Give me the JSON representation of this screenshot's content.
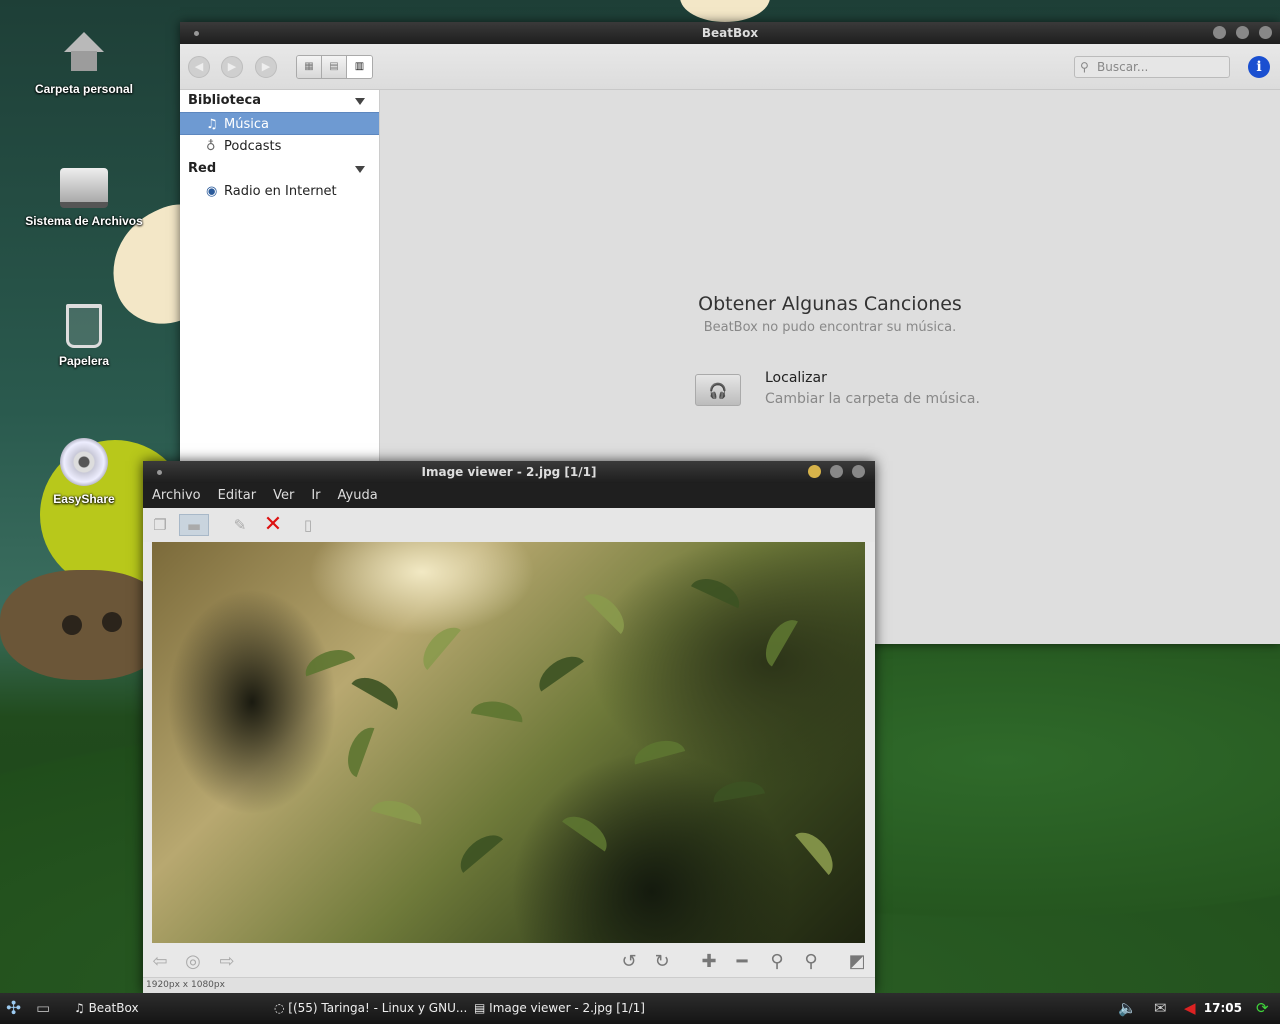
{
  "desktop": {
    "icons": [
      {
        "label": "Carpeta personal",
        "icon": "home-folder-icon"
      },
      {
        "label": "Sistema de Archivos",
        "icon": "drive-icon"
      },
      {
        "label": "Papelera",
        "icon": "trash-icon"
      },
      {
        "label": "EasyShare",
        "icon": "cd-icon"
      }
    ]
  },
  "beatbox": {
    "title": "BeatBox",
    "search_placeholder": "Buscar...",
    "info_label": "i",
    "sidebar": {
      "library_heading": "Biblioteca",
      "library_items": [
        {
          "label": "Música",
          "icon": "music-note-icon",
          "selected": true
        },
        {
          "label": "Podcasts",
          "icon": "podcast-icon",
          "selected": false
        }
      ],
      "network_heading": "Red",
      "network_items": [
        {
          "label": "Radio en Internet",
          "icon": "radio-icon"
        }
      ]
    },
    "empty": {
      "title": "Obtener Algunas Canciones",
      "subtitle": "BeatBox no pudo encontrar su música.",
      "action_title": "Localizar",
      "action_subtitle": "Cambiar la carpeta de música."
    }
  },
  "viewer": {
    "title": "Image viewer - 2.jpg [1/1]",
    "menu": [
      "Archivo",
      "Editar",
      "Ver",
      "Ir",
      "Ayuda"
    ],
    "status": "1920px x 1080px"
  },
  "taskbar": {
    "items": [
      {
        "label": "BeatBox",
        "icon": "music-note-icon"
      },
      {
        "label": "[(55) Taringa! - Linux y GNU...",
        "icon": "browser-icon"
      },
      {
        "label": "Image viewer - 2.jpg [1/1]",
        "icon": "image-viewer-icon"
      }
    ],
    "clock": "17:05"
  },
  "colors": {
    "selection": "#6e9ad2",
    "info_blue": "#1a4fd0",
    "delete_red": "#dd1111",
    "titlebar": "#1e1e1e"
  }
}
